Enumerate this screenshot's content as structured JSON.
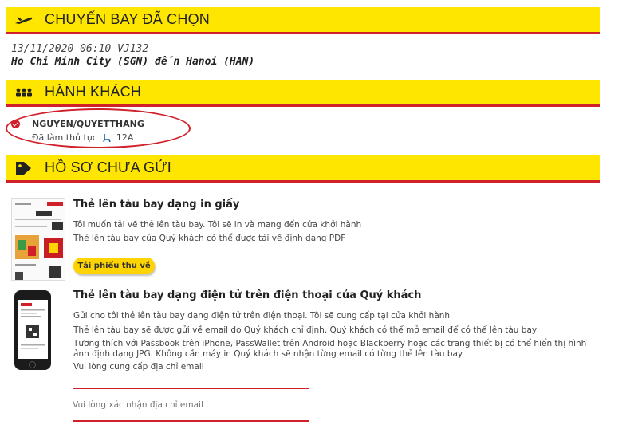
{
  "sections": {
    "selected_flight": {
      "title": "CHUYẾN BAY ĐÃ CHỌN",
      "icon": "plane-icon"
    },
    "passengers": {
      "title": "HÀNH KHÁCH",
      "icon": "people-icon"
    },
    "unsent_docs": {
      "title": "HỒ SƠ CHƯA GỬI",
      "icon": "tag-arrow-icon"
    }
  },
  "flight": {
    "datetime_flight": "13/11/2020 06:10 VJ132",
    "route": "Ho Chi Minh City (SGN) đến Hanoi (HAN)"
  },
  "passenger": {
    "name": "NGUYEN/QUYETTHANG",
    "status": "Đã làm thủ tục",
    "seat": "12A"
  },
  "paper_boarding": {
    "title": "Thẻ lên tàu bay dạng in giấy",
    "line1": "Tôi muốn tải về thẻ lên tàu bay. Tôi sẽ in và mang đến cửa khởi hành",
    "line2": "Thẻ lên tàu bay của Quý khách có thể được tải về định dạng PDF",
    "button": "Tải phiếu thu về"
  },
  "mobile_boarding": {
    "title": "Thẻ lên tàu bay dạng điện tử trên điện thoại của Quý khách",
    "line1": "Gửi cho tôi thẻ lên tàu bay dạng điện tử trên điện thoại. Tôi sẽ cung cấp tại cửa khởi hành",
    "line2": "Thẻ lên tàu bay sẽ được gửi về email do Quý khách chỉ định. Quý khách có thể mở email để có thể lên tàu bay",
    "line3": "Tương thích với Passbook trên iPhone, PassWallet trên Android hoặc Blackberry hoặc các trang thiết bị có thể hiển thị hình",
    "line4": "ảnh định dạng JPG. Không cần máy in Quý khách sẽ nhận từng email có từng thẻ lên tàu bay",
    "email_label": "Vui lòng cung cấp địa chỉ email",
    "confirm_email_placeholder": "Vui lòng xác nhận địa chỉ email"
  },
  "colors": {
    "bar": "#ffe600",
    "accent": "#d0202a",
    "button": "#ffd400"
  }
}
